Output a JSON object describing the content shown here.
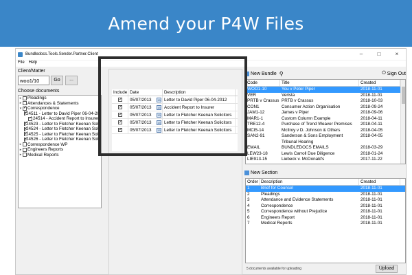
{
  "banner": {
    "title": "Amend your P4W Files"
  },
  "window": {
    "title": "Bundledocs.Tools.Sender.Partner.Client",
    "controls": {
      "minimize": "–",
      "maximize": "□",
      "close": "×"
    },
    "menu": [
      "File",
      "Help"
    ]
  },
  "client_matter": {
    "label": "Client/Matter",
    "value": "woo1/10",
    "go_label": "Go",
    "more_label": "..."
  },
  "documents": {
    "label": "Choose documents",
    "tree": [
      {
        "label": "Pleadings",
        "checked": false,
        "level": 0,
        "expander": "▸"
      },
      {
        "label": "Attendances & Statements",
        "checked": false,
        "level": 0,
        "expander": "▸"
      },
      {
        "label": "Correspondence",
        "checked": true,
        "level": 0,
        "expander": "▾"
      },
      {
        "label": "24511 - Letter to David Piper 06-04-2012",
        "checked": true,
        "level": 1,
        "expander": ""
      },
      {
        "label": "24514 - Accident Report to Insurer",
        "checked": true,
        "level": 1,
        "expander": ""
      },
      {
        "label": "24523 - Letter to Fletcher Keenan Solicitors",
        "checked": true,
        "level": 1,
        "expander": ""
      },
      {
        "label": "24524 - Letter to Fletcher Keenan Solicitors",
        "checked": true,
        "level": 1,
        "expander": ""
      },
      {
        "label": "24525 - Letter to Fletcher Keenan Solicitors",
        "checked": true,
        "level": 1,
        "expander": ""
      },
      {
        "label": "24526 - Letter to Fletcher Keenan Solicitors",
        "checked": true,
        "level": 1,
        "expander": ""
      },
      {
        "label": "Correspondence WP",
        "checked": false,
        "level": 0,
        "expander": "▸"
      },
      {
        "label": "Engineers Reports",
        "checked": false,
        "level": 0,
        "expander": "▸"
      },
      {
        "label": "Medical Reports",
        "checked": false,
        "level": 0,
        "expander": "▸"
      }
    ]
  },
  "selected_grid": {
    "columns": [
      "Include",
      "Date",
      "Description"
    ],
    "rows": [
      {
        "include": true,
        "date": "05/07/2013",
        "description": "Letter to David Piper 06-04-2012"
      },
      {
        "include": true,
        "date": "05/07/2013",
        "description": "Accident Report to Insurer"
      },
      {
        "include": true,
        "date": "05/07/2013",
        "description": "Letter to Fletcher Keenan Solicitors"
      },
      {
        "include": true,
        "date": "05/07/2013",
        "description": "Letter to Fletcher Keenan Solicitors"
      },
      {
        "include": true,
        "date": "05/07/2013",
        "description": "Letter to Fletcher Keenan Solicitors"
      }
    ],
    "calendar_glyph": "15",
    "move_up": "▲",
    "move_down": "▼"
  },
  "bundles": {
    "new_bundle_label": "New Bundle",
    "sign_out_label": "Sign Out",
    "columns": [
      "Code",
      "Title",
      "Created"
    ],
    "rows": [
      {
        "code": "WOO1-10",
        "title": "You v Peter Piper",
        "created": "2018-11-01",
        "selected": true
      },
      {
        "code": "VER",
        "title": "Verista",
        "created": "2018-11-01"
      },
      {
        "code": "PRTB v Crassus",
        "title": "PRTB v Crassus",
        "created": "2018-10-03"
      },
      {
        "code": "CON1",
        "title": "Consumer Action Organisation",
        "created": "2018-09-24"
      },
      {
        "code": "JAM1-12",
        "title": "James v Piper",
        "created": "2018-09-06"
      },
      {
        "code": "MAR1-1",
        "title": "Custom Column Example",
        "created": "2018-04-11"
      },
      {
        "code": "TRE12-4",
        "title": "Purchase of Trend Weaver Premises",
        "created": "2018-04-11"
      },
      {
        "code": "MCI5-14",
        "title": "McIlroy v D. Johnson & Others",
        "created": "2018-04-05"
      },
      {
        "code": "SAN2-91",
        "title": "Sanderson & Sons Employment Tribunal Hearing",
        "created": "2018-04-05"
      },
      {
        "code": "EMAIL",
        "title": "BUNDLEDOCS EMAILS",
        "created": "2018-03-29"
      },
      {
        "code": "LEW23-18",
        "title": "Lewis Carroll Due Diligence",
        "created": "2018-01-24"
      },
      {
        "code": "LIE913-15",
        "title": "Liebeck v. McDonald's",
        "created": "2017-11-22"
      }
    ]
  },
  "sections": {
    "new_section_label": "New Section",
    "columns": [
      "Order",
      "Description",
      "Created"
    ],
    "rows": [
      {
        "order": "1",
        "description": "Brief for Counsel",
        "created": "2018-11-01",
        "selected": true
      },
      {
        "order": "2",
        "description": "Pleadings",
        "created": "2018-11-01"
      },
      {
        "order": "3",
        "description": "Attendance and Evidence Statements",
        "created": "2018-11-01"
      },
      {
        "order": "4",
        "description": "Correspondence",
        "created": "2018-11-01"
      },
      {
        "order": "5",
        "description": "Correspondence without Prejudice",
        "created": "2018-11-01"
      },
      {
        "order": "6",
        "description": "Engineers Report",
        "created": "2018-11-01"
      },
      {
        "order": "7",
        "description": "Medical Reports",
        "created": "2018-11-01"
      }
    ]
  },
  "status": {
    "text": "5 documents available for uploading",
    "upload_label": "Upload"
  },
  "colors": {
    "banner": "#3a86c8",
    "selection": "#3399ff",
    "highlight_frame": "#2d2d2d"
  }
}
